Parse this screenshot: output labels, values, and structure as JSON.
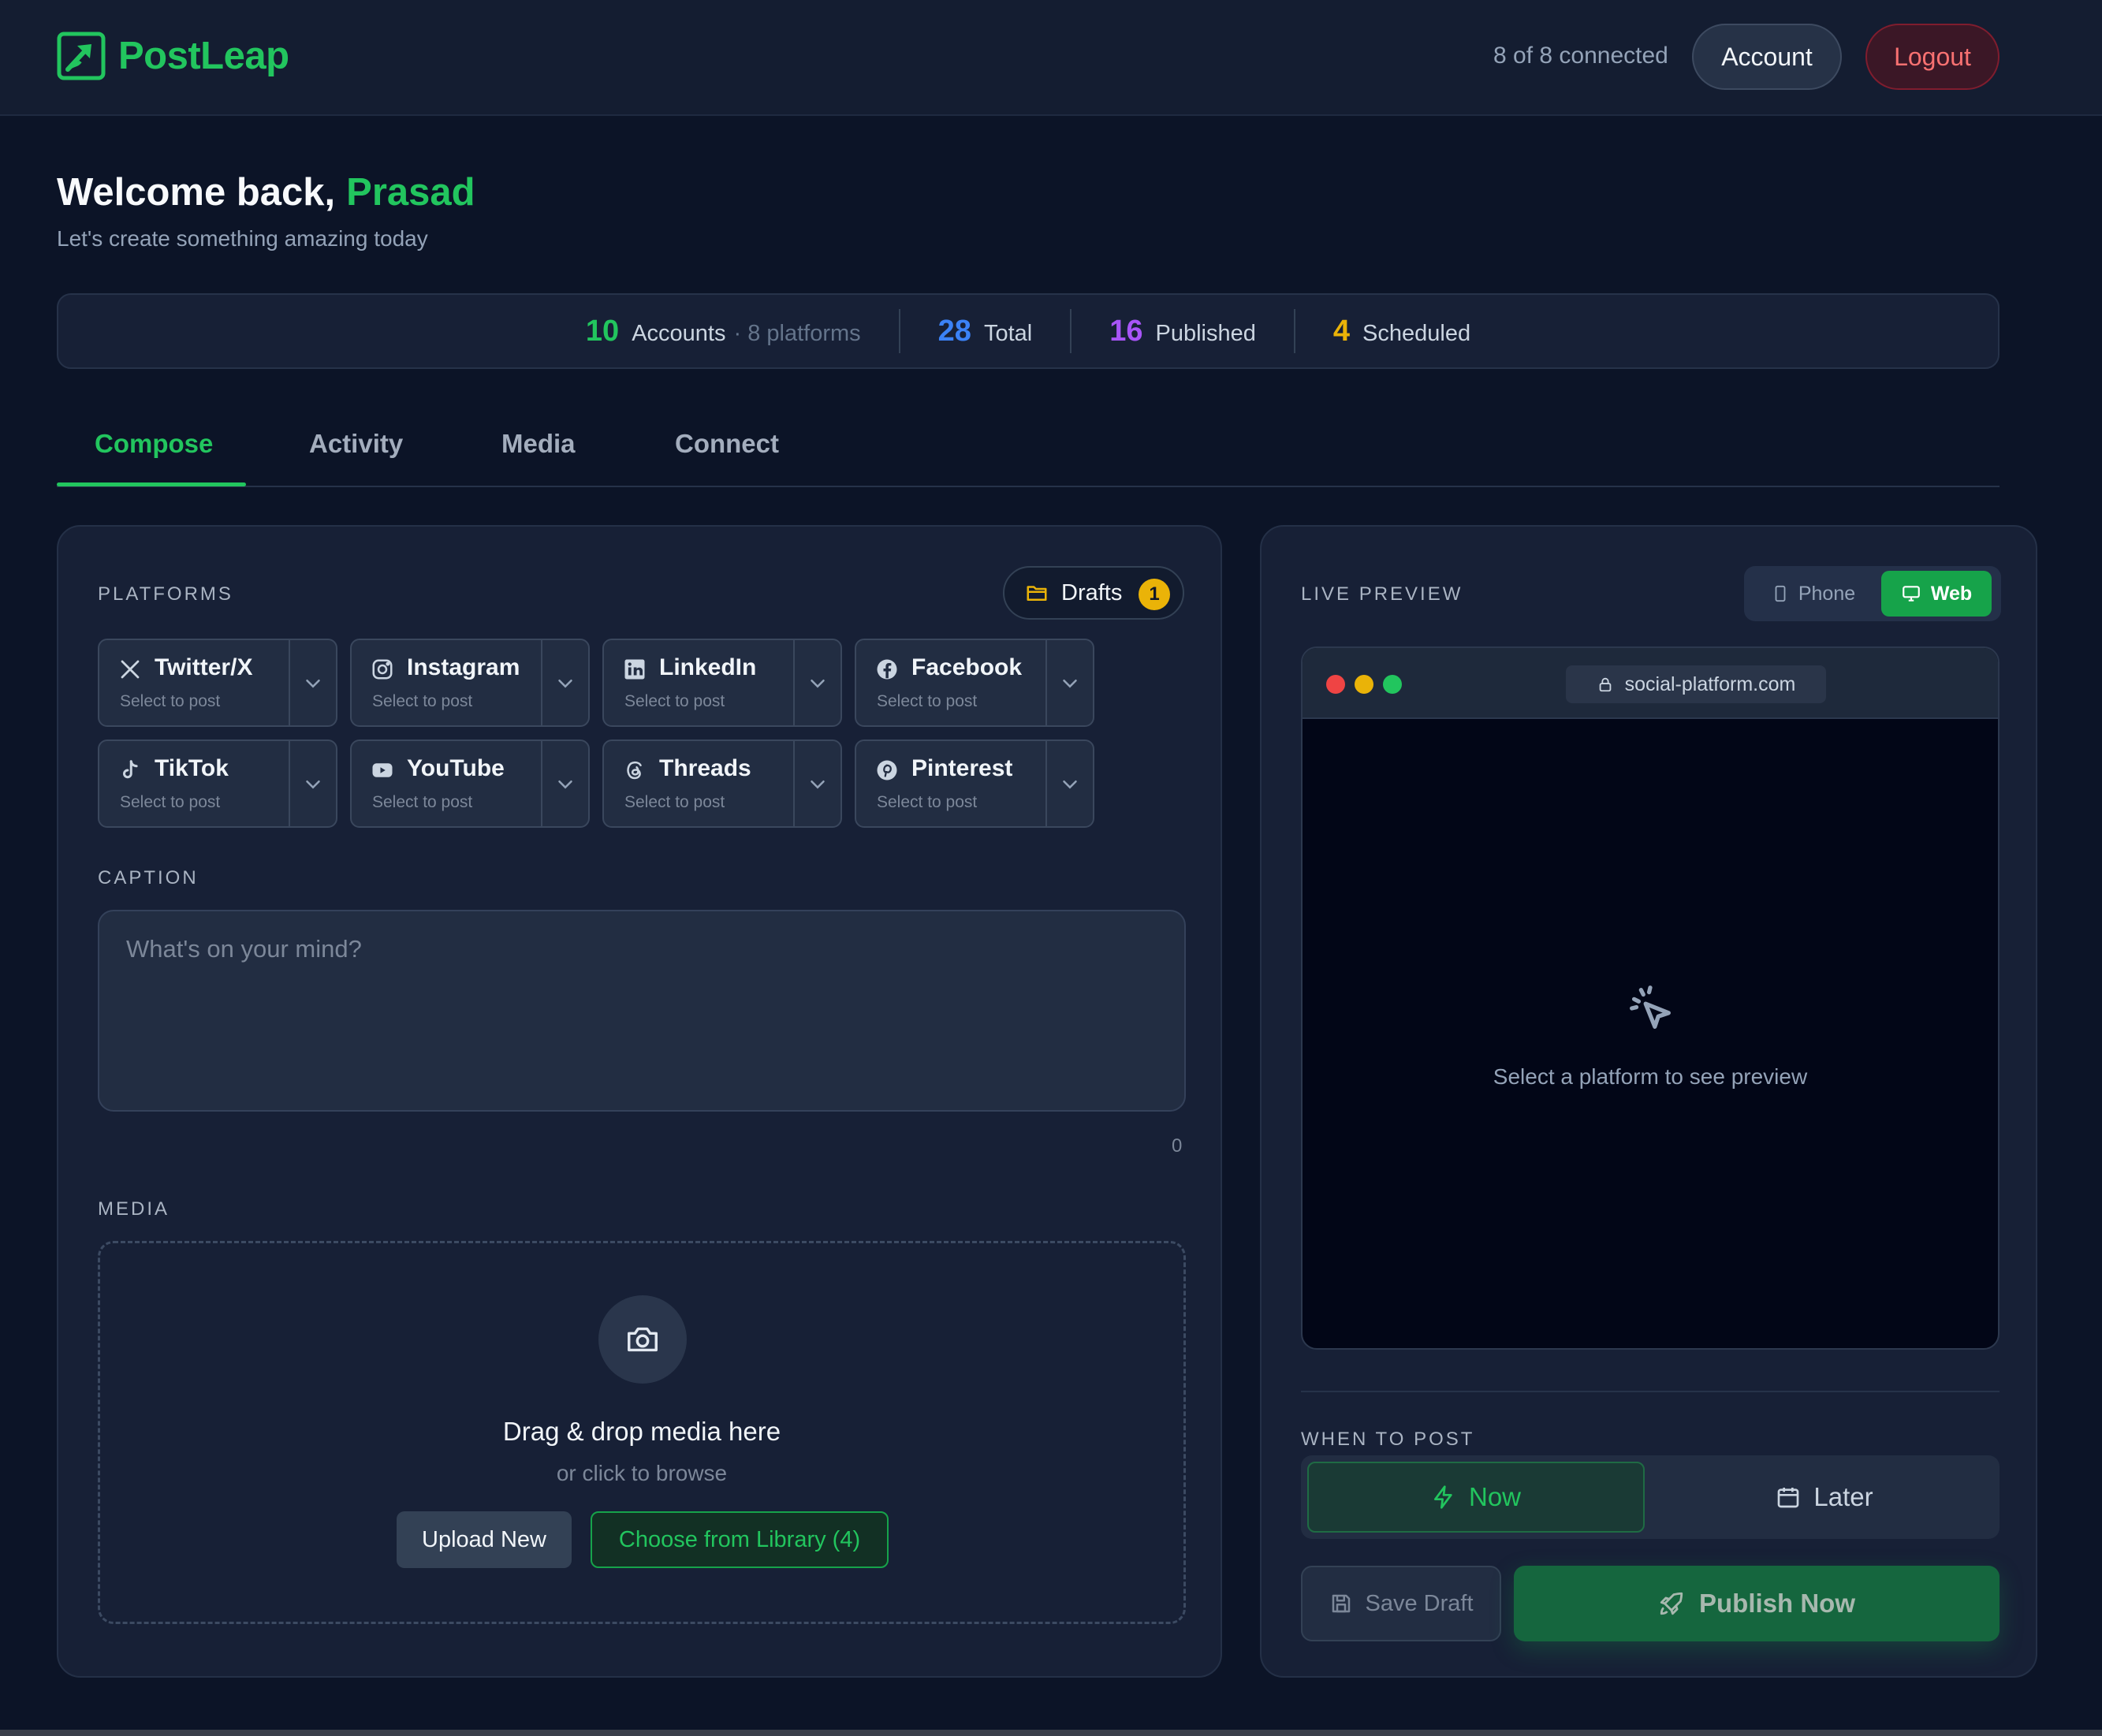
{
  "app": {
    "name": "PostLeap"
  },
  "header": {
    "connection_status": "8 of 8 connected",
    "account_label": "Account",
    "logout_label": "Logout"
  },
  "welcome": {
    "greeting": "Welcome back,",
    "user_name": "Prasad",
    "subtitle": "Let's create something amazing today"
  },
  "stats": {
    "accounts": {
      "value": "10",
      "label": "Accounts",
      "extra": "· 8 platforms",
      "color": "#22c55e"
    },
    "total": {
      "value": "28",
      "label": "Total",
      "color": "#3b82f6"
    },
    "published": {
      "value": "16",
      "label": "Published",
      "color": "#a855f7"
    },
    "scheduled": {
      "value": "4",
      "label": "Scheduled",
      "color": "#eab308"
    }
  },
  "tabs": [
    {
      "label": "Compose",
      "active": true
    },
    {
      "label": "Activity",
      "active": false
    },
    {
      "label": "Media",
      "active": false
    },
    {
      "label": "Connect",
      "active": false
    }
  ],
  "compose": {
    "platforms_label": "PLATFORMS",
    "drafts": {
      "label": "Drafts",
      "count": "1",
      "icon": "folder-icon"
    },
    "platforms": [
      {
        "name": "Twitter/X",
        "status": "Select to post",
        "icon": "x-icon"
      },
      {
        "name": "Instagram",
        "status": "Select to post",
        "icon": "instagram-icon"
      },
      {
        "name": "LinkedIn",
        "status": "Select to post",
        "icon": "linkedin-icon"
      },
      {
        "name": "Facebook",
        "status": "Select to post",
        "icon": "facebook-icon"
      },
      {
        "name": "TikTok",
        "status": "Select to post",
        "icon": "tiktok-icon"
      },
      {
        "name": "YouTube",
        "status": "Select to post",
        "icon": "youtube-icon"
      },
      {
        "name": "Threads",
        "status": "Select to post",
        "icon": "threads-icon"
      },
      {
        "name": "Pinterest",
        "status": "Select to post",
        "icon": "pinterest-icon"
      }
    ],
    "caption_label": "CAPTION",
    "caption_placeholder": "What's on your mind?",
    "char_count": "0",
    "media_label": "MEDIA",
    "drop_title": "Drag & drop media here",
    "drop_subtitle": "or click to browse",
    "upload_label": "Upload New",
    "library_label": "Choose from Library (4)"
  },
  "preview": {
    "label": "LIVE PREVIEW",
    "phone_label": "Phone",
    "web_label": "Web",
    "url": "social-platform.com",
    "empty_message": "Select a platform to see preview",
    "when_label": "WHEN TO POST",
    "now_label": "Now",
    "later_label": "Later",
    "save_draft_label": "Save Draft",
    "publish_label": "Publish Now"
  },
  "colors": {
    "accent": "#22c55e",
    "background": "#0c1427",
    "card": "#172036",
    "danger": "#f87171"
  }
}
